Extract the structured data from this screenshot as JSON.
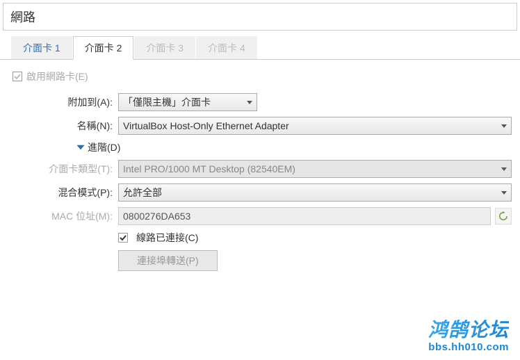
{
  "header": {
    "title": "網路"
  },
  "tabs": {
    "items": [
      {
        "label": "介面卡 1"
      },
      {
        "label": "介面卡 2"
      },
      {
        "label": "介面卡 3"
      },
      {
        "label": "介面卡 4"
      }
    ],
    "active_index": 1
  },
  "form": {
    "enable_adapter_label": "啟用網路卡(E)",
    "enable_adapter_checked": true,
    "attached_to_label": "附加到(A):",
    "attached_to_value": "「僅限主機」介面卡",
    "name_label": "名稱(N):",
    "name_value": "VirtualBox Host-Only Ethernet Adapter",
    "advanced_label": "進階(D)",
    "adapter_type_label": "介面卡類型(T):",
    "adapter_type_value": "Intel PRO/1000 MT Desktop (82540EM)",
    "promiscuous_label": "混合模式(P):",
    "promiscuous_value": "允許全部",
    "mac_label": "MAC 位址(M):",
    "mac_value": "0800276DA653",
    "cable_connected_label": "線路已連接(C)",
    "cable_connected_checked": true,
    "port_forwarding_label": "連接埠轉送(P)"
  },
  "watermark": {
    "top": "鸿鹄论坛",
    "bottom": "bbs.hh010.com"
  }
}
